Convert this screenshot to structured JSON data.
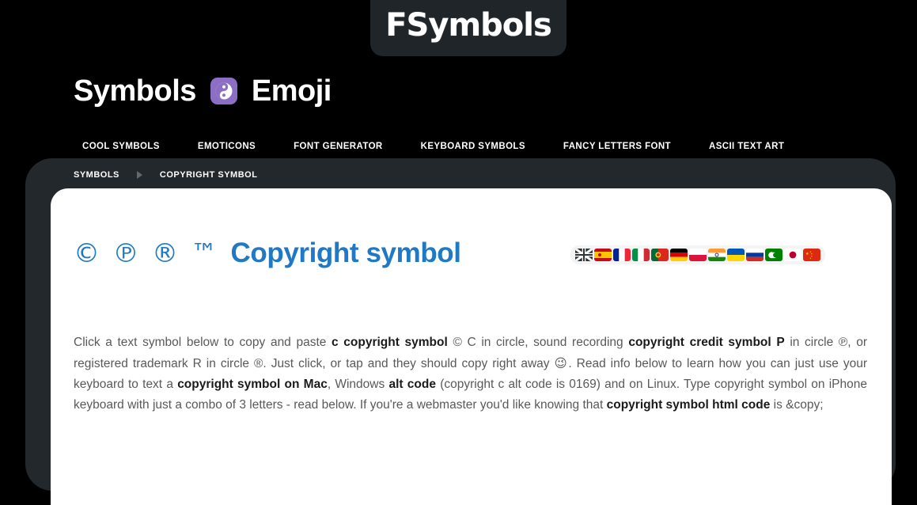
{
  "site": {
    "logo_text": "FSymbols",
    "brand_word_1": "Symbols",
    "brand_icon": "yin-yang-icon",
    "brand_word_2": "Emoji",
    "accent_color": "#2079c4",
    "badge_color": "#8c6fc4",
    "panel_color": "#23282c",
    "background_color": "#000000"
  },
  "nav": {
    "items": [
      {
        "label": "COOL SYMBOLS"
      },
      {
        "label": "EMOTICONS"
      },
      {
        "label": "FONT GENERATOR"
      },
      {
        "label": "KEYBOARD SYMBOLS"
      },
      {
        "label": "FANCY LETTERS FONT"
      },
      {
        "label": "ASCII TEXT ART"
      }
    ]
  },
  "breadcrumb": {
    "root": "SYMBOLS",
    "separator": "chevron-right-icon",
    "current": "COPYRIGHT SYMBOL"
  },
  "page": {
    "symbol_prefix": "© ℗ ® ™",
    "title": "Copyright symbol"
  },
  "languages": [
    {
      "name": "flag-united-kingdom"
    },
    {
      "name": "flag-spain"
    },
    {
      "name": "flag-france"
    },
    {
      "name": "flag-italy"
    },
    {
      "name": "flag-portugal"
    },
    {
      "name": "flag-germany"
    },
    {
      "name": "flag-poland"
    },
    {
      "name": "flag-india"
    },
    {
      "name": "flag-ukraine"
    },
    {
      "name": "flag-russia"
    },
    {
      "name": "flag-mauritania"
    },
    {
      "name": "flag-japan"
    },
    {
      "name": "flag-china"
    }
  ],
  "intro": {
    "part_1": "Click a text symbol below to copy and paste ",
    "bold_1": "c copyright symbol",
    "part_2": " © C in circle, sound recording ",
    "bold_2": "copyright credit symbol P",
    "part_3": " in circle ℗, or registered trademark R in circle ®. Just click, or tap and they should copy right away ",
    "emoji": "😉",
    "part_4": ". Read info below to learn how you can just use your keyboard to text a ",
    "bold_3": "copyright symbol on Mac",
    "part_5": ", Windows ",
    "bold_4": "alt code",
    "part_6": " (copyright c alt code is 0169) and on Linux. Type copyright symbol on iPhone keyboard with just a combo of 3 letters - read below. If you're a webmaster you'd like knowing that ",
    "bold_5": "copyright symbol html code",
    "part_7": " is &copy;"
  }
}
